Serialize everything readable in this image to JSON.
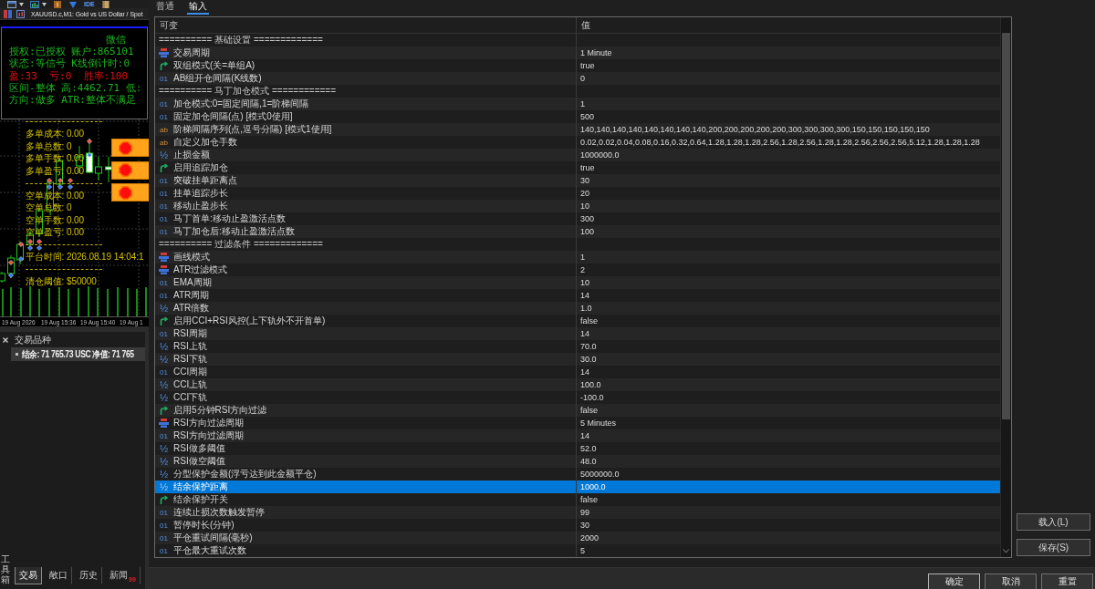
{
  "terminal": {
    "toolbar": {
      "ide_label": "IDE"
    },
    "chart": {
      "title": "XAUUSD.c,M1: Gold vs US Dollar / Spot",
      "info_lines": [
        {
          "kind": "heading",
          "text": "微信",
          "color": "#1db41d"
        },
        {
          "kind": "line",
          "text": "授权:已授权 账户:865101",
          "color": "#1db41d"
        },
        {
          "kind": "line",
          "text": "状态:等信号 K线倒计时:0",
          "color": "#1db41d"
        },
        {
          "kind": "line",
          "text": "盈:33  亏:0  胜率:100",
          "color": "#e01010"
        },
        {
          "kind": "line",
          "text": "区间-整体 高:4462.71 低:",
          "color": "#1db41d"
        },
        {
          "kind": "line",
          "text": "方向:做多 ATR:整体不满足",
          "color": "#1db41d"
        }
      ],
      "long_stats": [
        "多单成本: 0.00",
        "多单总数: 0",
        "多单手数: 0.00",
        "多单盈亏: 0.00"
      ],
      "short_stats": [
        "空单成本: 0.00",
        "空单总数: 0",
        "空单手数: 0.00",
        "空单盈亏: 0.00"
      ],
      "platform_time": "平台时间: 2026.08.19 14:04:1",
      "close_threshold": "清仓阈值: $50000",
      "x_labels": [
        "19 Aug 2026",
        "19 Aug 15:36",
        "19 Aug 15:40",
        "19 Aug 1"
      ]
    },
    "symbols_panel": {
      "title": "交易品种",
      "balance": "结余: 71 765.73 USC 净值: 71 765"
    },
    "toolbox_label": "工具箱",
    "tabs": [
      {
        "label": "交易",
        "selected": true
      },
      {
        "label": "敞口",
        "selected": false
      },
      {
        "label": "历史",
        "selected": false
      },
      {
        "label": "新闻",
        "selected": false,
        "count": "99"
      }
    ]
  },
  "dialog": {
    "tabs": [
      {
        "label": "普通",
        "selected": false
      },
      {
        "label": "输入",
        "selected": true
      }
    ],
    "table": {
      "columns": [
        "可变",
        "值"
      ],
      "rows": [
        {
          "kind": "separator",
          "name": "========== 基础设置 =============",
          "selected": false
        },
        {
          "kind": "enum",
          "name": "交易周期",
          "value": "1 Minute",
          "selected": false
        },
        {
          "kind": "bool",
          "name": "双组模式(关=单组A)",
          "value": "true",
          "selected": false
        },
        {
          "kind": "int",
          "type_code": "01",
          "name": "AB组开仓间隔(K线数)",
          "value": "0",
          "selected": false
        },
        {
          "kind": "separator",
          "name": "========== 马丁加仓模式 ============",
          "selected": false
        },
        {
          "kind": "int",
          "type_code": "01",
          "name": "加仓模式:0=固定间隔,1=阶梯间隔",
          "value": "1",
          "selected": false
        },
        {
          "kind": "int",
          "type_code": "01",
          "name": "固定加仓间隔(点) [模式0使用]",
          "value": "500",
          "selected": false
        },
        {
          "kind": "string",
          "type_code": "ab",
          "name": "阶梯间隔序列(点,逗号分隔) [模式1使用]",
          "value": "140,140,140,140,140,140,140,140,200,200,200,200,200,300,300,300,300,150,150,150,150,150",
          "selected": false
        },
        {
          "kind": "string",
          "type_code": "ab",
          "name": "自定义加仓手数",
          "value": "0.02,0.02,0.04,0.08,0.16,0.32,0.64,1.28,1.28,1.28,2.56,1.28,2.56,1.28,1.28,2.56,2.56,2.56,5.12,1.28,1.28,1.28",
          "selected": false
        },
        {
          "kind": "double",
          "type_code": "½",
          "name": "止损金额",
          "value": "1000000.0",
          "selected": false
        },
        {
          "kind": "bool",
          "name": "启用追踪加仓",
          "value": "true",
          "selected": false
        },
        {
          "kind": "int",
          "type_code": "01",
          "name": "突破挂单距离点",
          "value": "30",
          "selected": false
        },
        {
          "kind": "int",
          "type_code": "01",
          "name": "挂单追踪步长",
          "value": "20",
          "selected": false
        },
        {
          "kind": "int",
          "type_code": "01",
          "name": "移动止盈步长",
          "value": "10",
          "selected": false
        },
        {
          "kind": "int",
          "type_code": "01",
          "name": "马丁首单:移动止盈激活点数",
          "value": "300",
          "selected": false
        },
        {
          "kind": "int",
          "type_code": "01",
          "name": "马丁加仓后:移动止盈激活点数",
          "value": "100",
          "selected": false
        },
        {
          "kind": "separator",
          "name": "========== 过滤条件 =============",
          "selected": false
        },
        {
          "kind": "enum",
          "name": "画线模式",
          "value": "1",
          "selected": false
        },
        {
          "kind": "enum",
          "name": "ATR过滤模式",
          "value": "2",
          "selected": false
        },
        {
          "kind": "int",
          "type_code": "01",
          "name": "EMA周期",
          "value": "10",
          "selected": false
        },
        {
          "kind": "int",
          "type_code": "01",
          "name": "ATR周期",
          "value": "14",
          "selected": false
        },
        {
          "kind": "double",
          "type_code": "½",
          "name": "ATR倍数",
          "value": "1.0",
          "selected": false
        },
        {
          "kind": "bool",
          "name": "启用CCI+RSI风控(上下轨外不开首单)",
          "value": "false",
          "selected": false
        },
        {
          "kind": "int",
          "type_code": "01",
          "name": "RSI周期",
          "value": "14",
          "selected": false
        },
        {
          "kind": "double",
          "type_code": "½",
          "name": "RSI上轨",
          "value": "70.0",
          "selected": false
        },
        {
          "kind": "double",
          "type_code": "½",
          "name": "RSI下轨",
          "value": "30.0",
          "selected": false
        },
        {
          "kind": "int",
          "type_code": "01",
          "name": "CCI周期",
          "value": "14",
          "selected": false
        },
        {
          "kind": "double",
          "type_code": "½",
          "name": "CCI上轨",
          "value": "100.0",
          "selected": false
        },
        {
          "kind": "double",
          "type_code": "½",
          "name": "CCI下轨",
          "value": "-100.0",
          "selected": false
        },
        {
          "kind": "bool",
          "name": "启用5分钟RSI方向过滤",
          "value": "false",
          "selected": false
        },
        {
          "kind": "enum",
          "name": "RSI方向过滤周期",
          "value": "5 Minutes",
          "selected": false
        },
        {
          "kind": "int",
          "type_code": "01",
          "name": "RSI方向过滤周期",
          "value": "14",
          "selected": false
        },
        {
          "kind": "double",
          "type_code": "½",
          "name": "RSI做多阈值",
          "value": "52.0",
          "selected": false
        },
        {
          "kind": "double",
          "type_code": "½",
          "name": "RSI做空阈值",
          "value": "48.0",
          "selected": false
        },
        {
          "kind": "double",
          "type_code": "½",
          "name": "分型保护金额(浮亏达到此金额平仓)",
          "value": "5000000.0",
          "selected": false
        },
        {
          "kind": "double",
          "type_code": "½",
          "name": "结余保护距离",
          "value": "1000.0",
          "selected": true
        },
        {
          "kind": "bool",
          "name": "结余保护开关",
          "value": "false",
          "selected": false
        },
        {
          "kind": "int",
          "type_code": "01",
          "name": "连续止损次数触发暂停",
          "value": "99",
          "selected": false
        },
        {
          "kind": "int",
          "type_code": "01",
          "name": "暂停时长(分钟)",
          "value": "30",
          "selected": false
        },
        {
          "kind": "int",
          "type_code": "01",
          "name": "平仓重试间隔(毫秒)",
          "value": "2000",
          "selected": false
        },
        {
          "kind": "int",
          "type_code": "01",
          "name": "平仓最大重试次数",
          "value": "5",
          "selected": false
        }
      ]
    },
    "side_buttons": [
      "载入(L)",
      "保存(S)"
    ],
    "buttons": [
      {
        "label": "确定",
        "default": true
      },
      {
        "label": "取消",
        "default": false
      },
      {
        "label": "重置",
        "default": false
      }
    ]
  }
}
